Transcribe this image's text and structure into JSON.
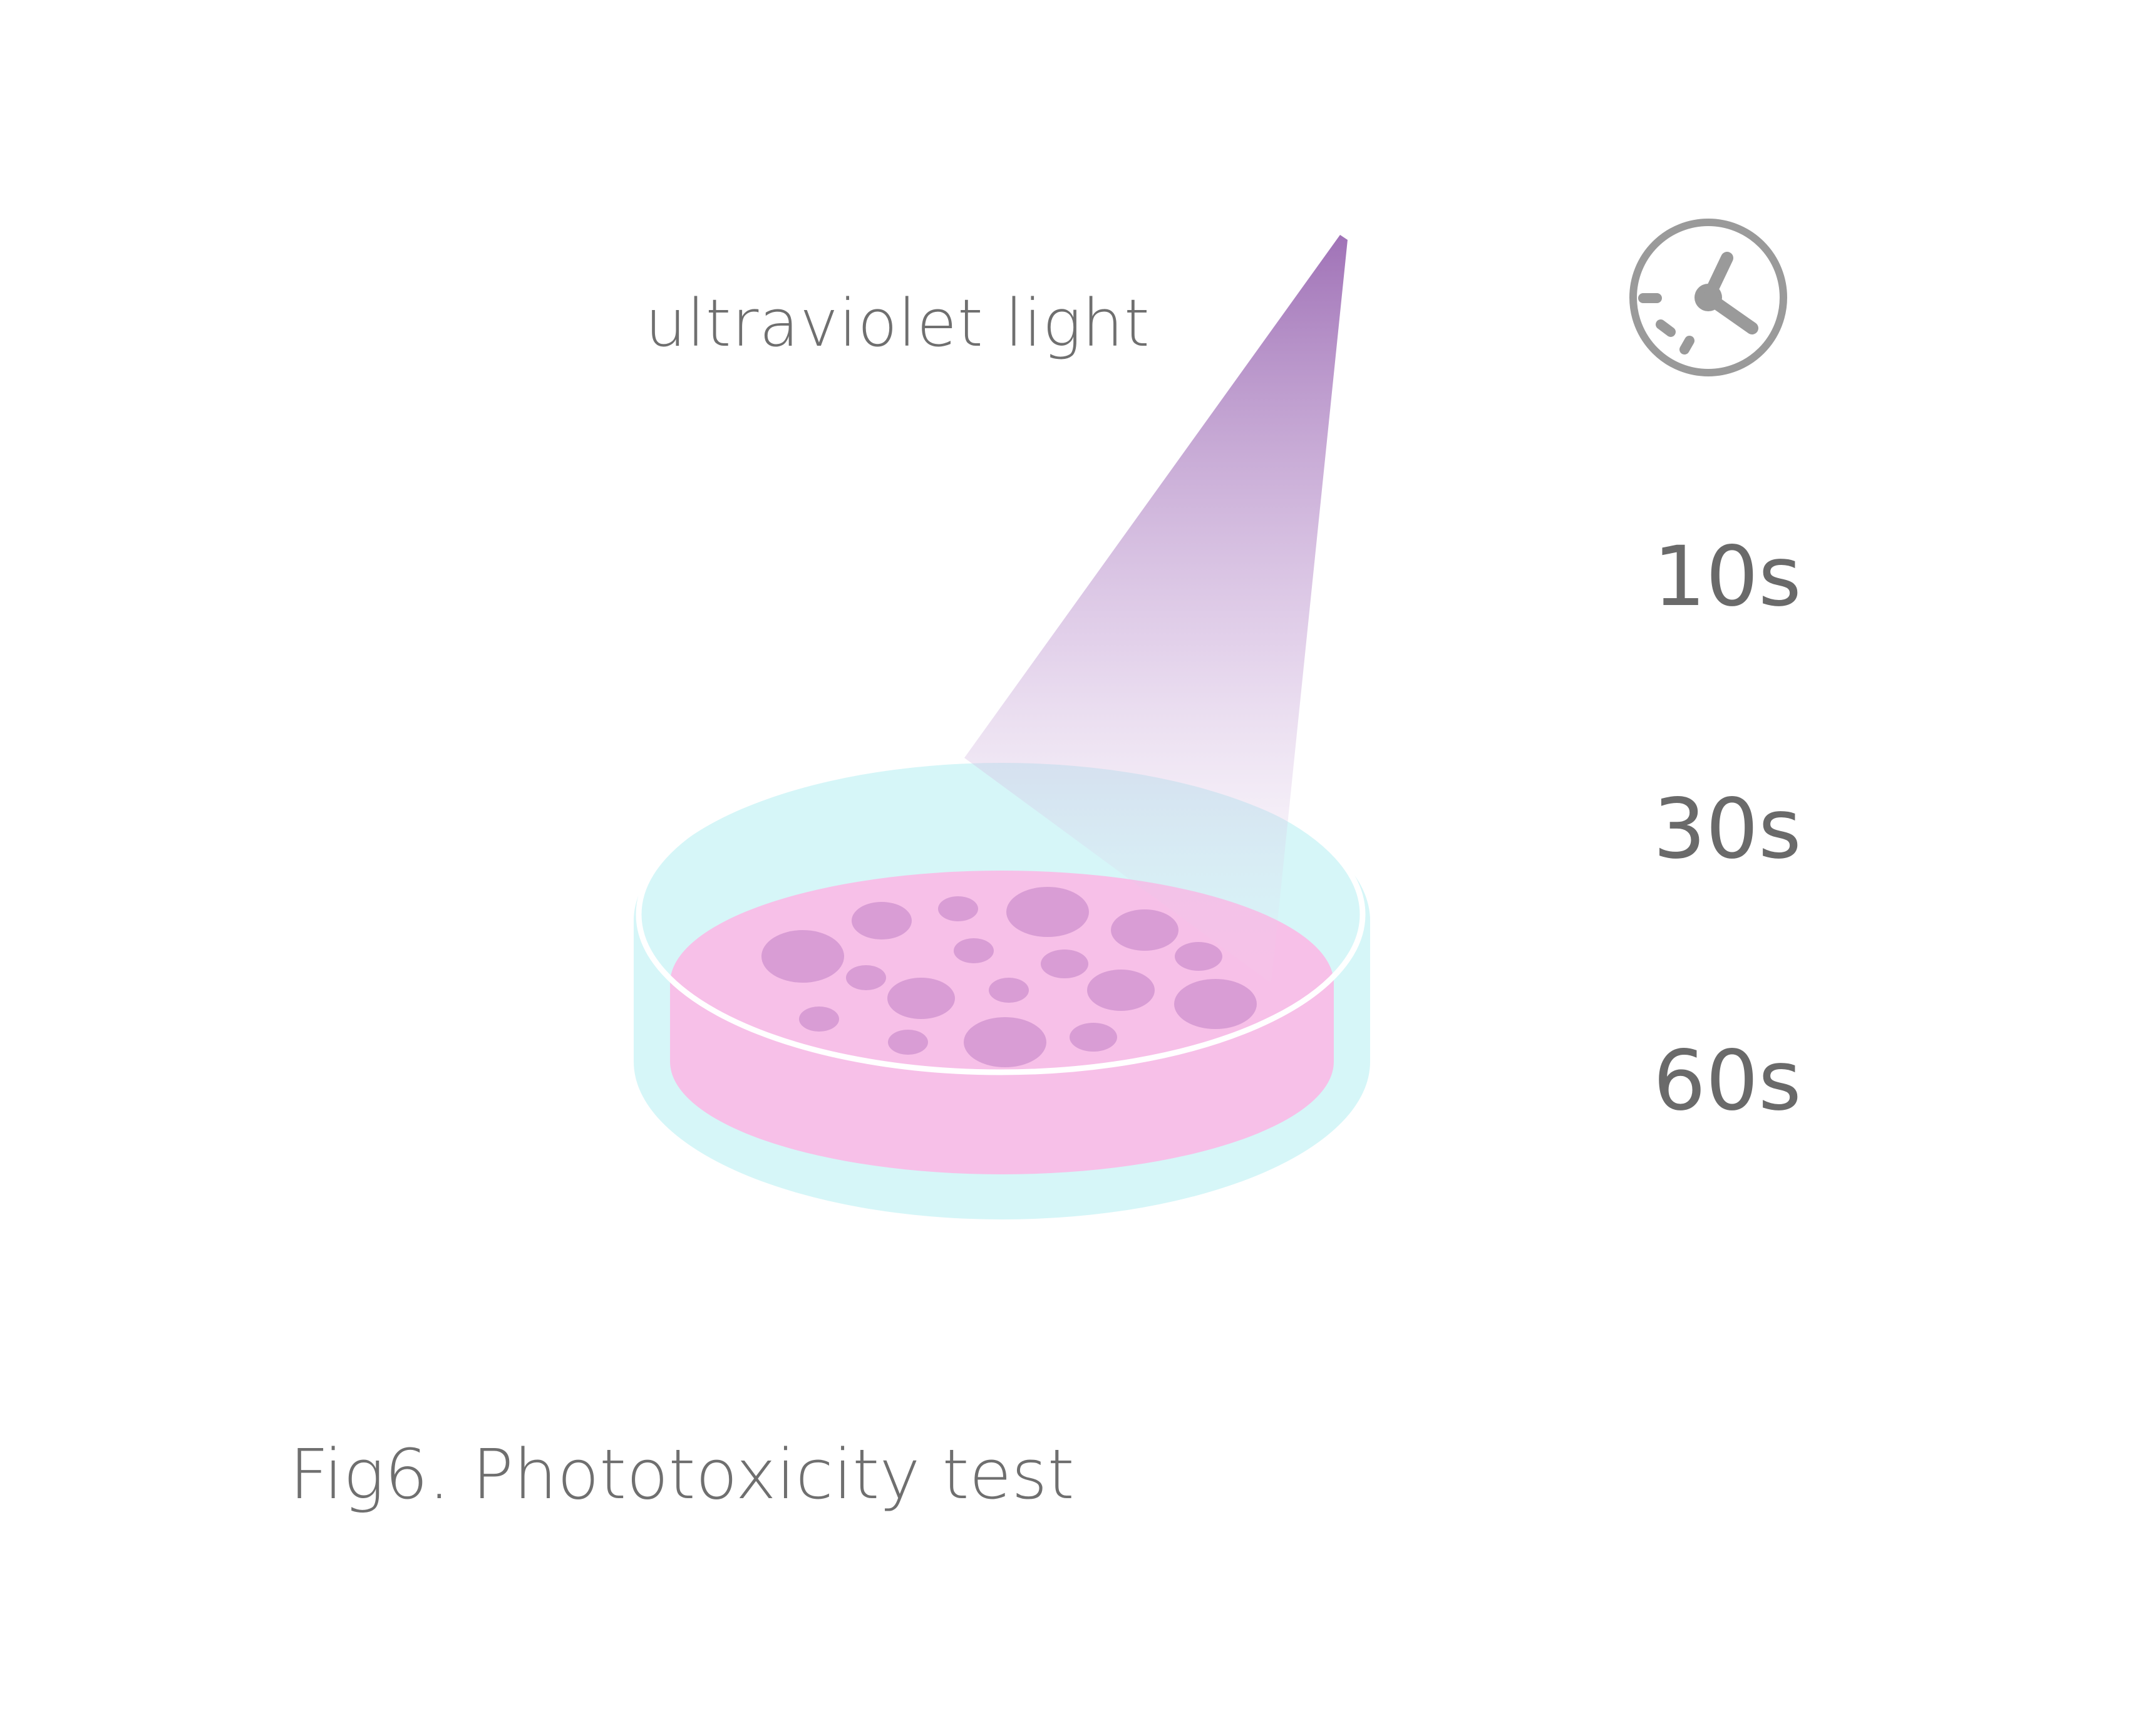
{
  "labels": {
    "light_label": "ultraviolet light",
    "caption": "Fig6. Phototoxicity test"
  },
  "exposure_times": [
    "10s",
    "30s",
    "60s"
  ],
  "icons": {
    "timer": "stopwatch-clock-icon"
  },
  "colors": {
    "text": "#6f6f6f",
    "beam_top": "#9b6bb3",
    "dish_glass": "#d6f6f8",
    "dish_rim": "#ffffff",
    "culture_medium": "#f7c0e8",
    "cell_colonies": "#d99dd5",
    "icon_gray": "#9a9a9a"
  }
}
